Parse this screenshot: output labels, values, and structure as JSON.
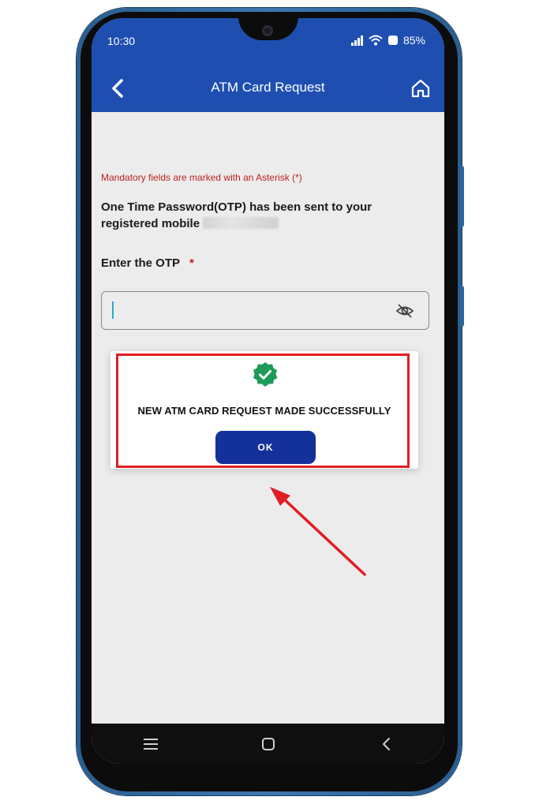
{
  "status_bar": {
    "time": "10:30",
    "battery": "85%",
    "icons": [
      "signal-icon",
      "wifi-icon",
      "battery-icon"
    ]
  },
  "header": {
    "title": "ATM Card Request",
    "back_icon": "chevron-left-icon",
    "home_icon": "home-icon"
  },
  "form": {
    "mandatory_note": "Mandatory fields are marked with an Asterisk (*)",
    "otp_message": "One Time Password(OTP) has been sent to your registered mobile",
    "masked_mobile_prefix": "xxxxxx",
    "otp_label": "Enter the OTP",
    "required_marker": "*",
    "otp_value": "",
    "visibility_icon": "eye-off-icon"
  },
  "dialog": {
    "icon": "verified-check-icon",
    "message": "NEW ATM CARD REQUEST MADE SUCCESSFULLY",
    "ok_label": "OK"
  },
  "nav_bar": {
    "items": [
      "menu-icon",
      "home-square-icon",
      "back-icon"
    ]
  },
  "colors": {
    "header_blue": "#1e4fb0",
    "button_navy": "#14309a",
    "required_red": "#c01f1f",
    "highlight_red": "#e21d24",
    "success_green": "#1e9b5a"
  }
}
